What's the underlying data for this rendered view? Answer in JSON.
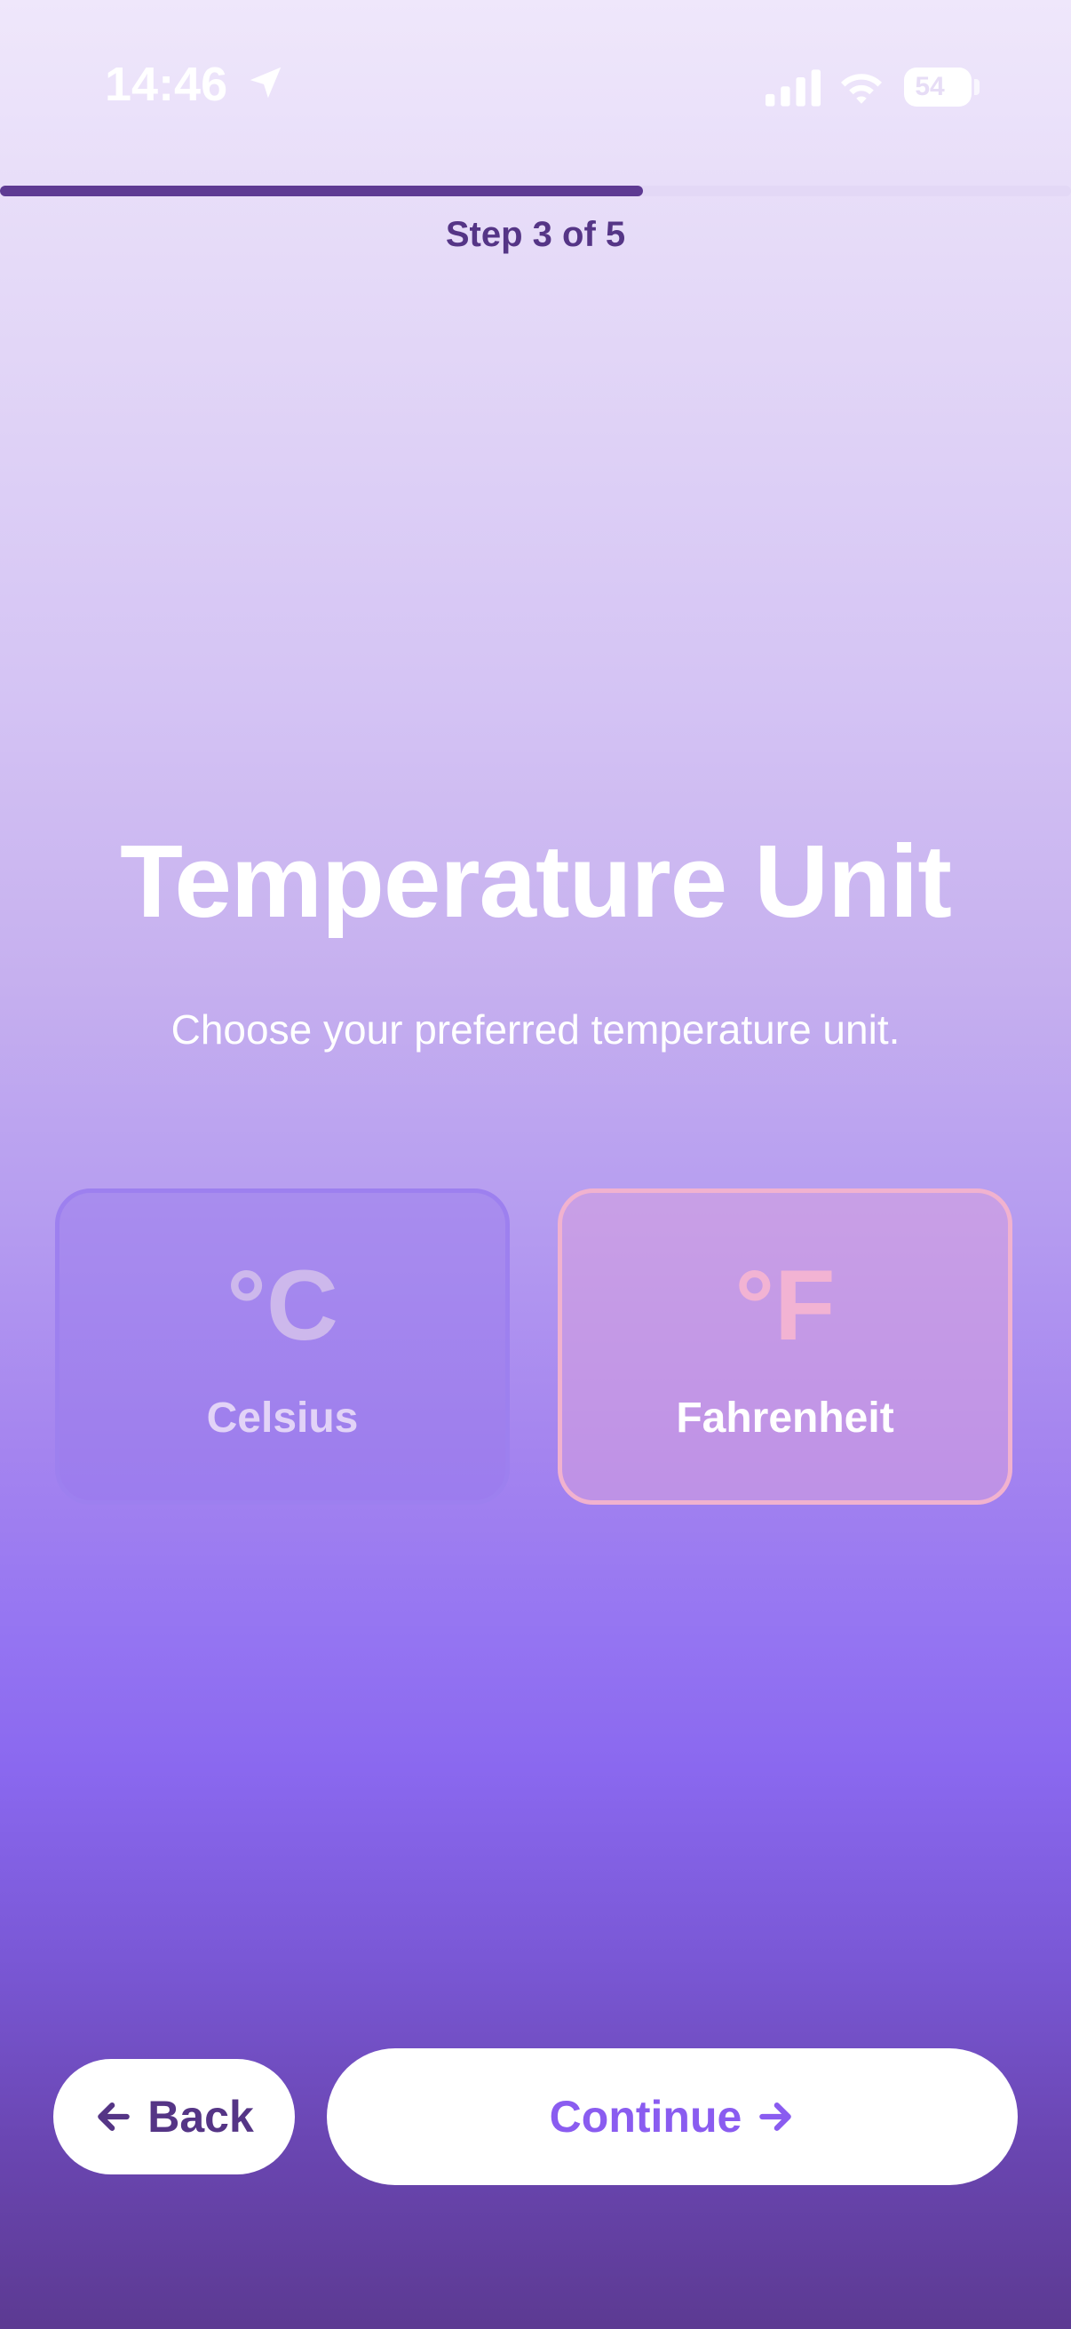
{
  "status_bar": {
    "time": "14:46",
    "battery": "54"
  },
  "progress": {
    "step_text": "Step 3 of 5",
    "fraction": 0.6
  },
  "title": "Temperature Unit",
  "subtitle": "Choose your preferred temperature unit.",
  "options": [
    {
      "symbol": "°C",
      "label": "Celsius",
      "selected": false
    },
    {
      "symbol": "°F",
      "label": "Fahrenheit",
      "selected": true
    }
  ],
  "buttons": {
    "back": "Back",
    "continue": "Continue"
  },
  "icons": [
    "location-arrow-icon",
    "cellular-signal-icon",
    "wifi-icon",
    "battery-icon",
    "arrow-left-icon",
    "arrow-right-icon"
  ],
  "colors": {
    "accent": "#8a5cf0",
    "dark_purple": "#553586",
    "selected_border": "#f1b2cf"
  }
}
